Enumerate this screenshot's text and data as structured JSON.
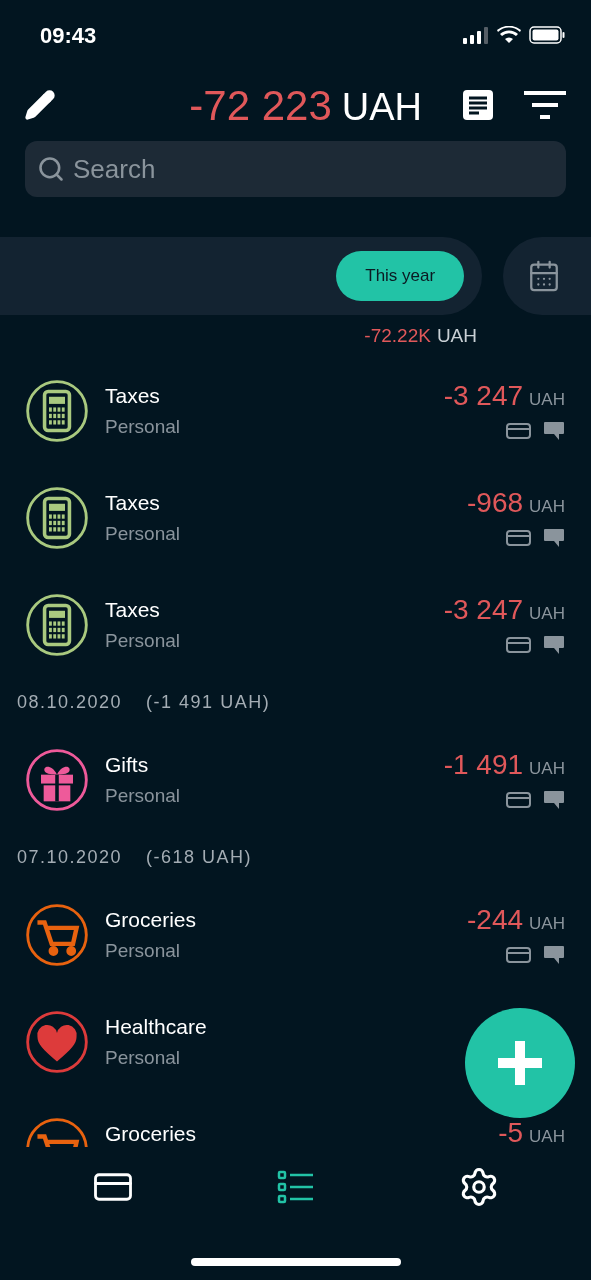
{
  "status_bar": {
    "time": "09:43"
  },
  "header": {
    "amount": "-72 223",
    "currency": "UAH"
  },
  "search": {
    "placeholder": "Search"
  },
  "period": {
    "chip": {
      "label": "This year",
      "selected": true
    },
    "total_amount": "-72.22K",
    "total_currency": "UAH"
  },
  "list": [
    {
      "kind": "taxes",
      "color": "#a9c97f",
      "title": "Taxes",
      "subtitle": "Personal",
      "amount": "-3 247",
      "currency": "UAH"
    },
    {
      "kind": "taxes",
      "color": "#a9c97f",
      "title": "Taxes",
      "subtitle": "Personal",
      "amount": "-968",
      "currency": "UAH"
    },
    {
      "kind": "taxes",
      "color": "#a9c97f",
      "title": "Taxes",
      "subtitle": "Personal",
      "amount": "-3 247",
      "currency": "UAH"
    },
    {
      "kind": "date",
      "date": "08.10.2020",
      "total": "(-1 491 UAH)"
    },
    {
      "kind": "gifts",
      "color": "#ee5a9a",
      "title": "Gifts",
      "subtitle": "Personal",
      "amount": "-1 491",
      "currency": "UAH"
    },
    {
      "kind": "date",
      "date": "07.10.2020",
      "total": "(-618 UAH)"
    },
    {
      "kind": "groceries",
      "color": "#e8620f",
      "title": "Groceries",
      "subtitle": "Personal",
      "amount": "-244",
      "currency": "UAH"
    },
    {
      "kind": "healthcare",
      "color": "#dd3b3b",
      "title": "Healthcare",
      "subtitle": "Personal"
    },
    {
      "kind": "groceries",
      "color": "#e8620f",
      "title": "Groceries",
      "amount": "-5",
      "currency": "UAH"
    }
  ],
  "tabs": [
    {
      "selected": false
    },
    {
      "selected": true
    },
    {
      "selected": false
    }
  ]
}
